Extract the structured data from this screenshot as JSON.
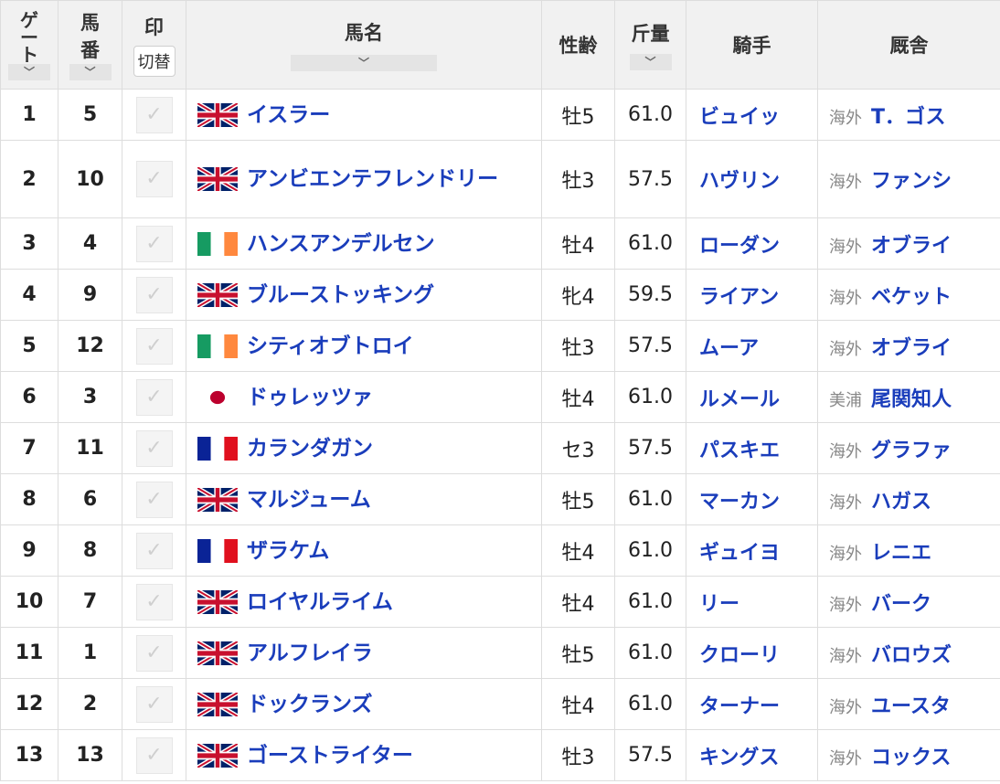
{
  "headers": {
    "gate": [
      "ゲ",
      "ー",
      "ト"
    ],
    "number": [
      "馬",
      "番"
    ],
    "mark": "印",
    "mark_toggle": "切替",
    "horse": "馬名",
    "sex_age": "性齢",
    "weight": "斤量",
    "jockey": "騎手",
    "stable": "厩舎",
    "sort_icon": "﹀"
  },
  "check_glyph": "✓",
  "rows": [
    {
      "gate": "1",
      "num": "5",
      "flag": "gb",
      "horse": "イスラー",
      "sex_age": "牡5",
      "weight": "61.0",
      "jockey": "ビュイッ",
      "region": "海外",
      "trainer": "T．ゴス"
    },
    {
      "gate": "2",
      "num": "10",
      "flag": "gb",
      "horse": "アンビエンテフレンドリー",
      "sex_age": "牡3",
      "weight": "57.5",
      "jockey": "ハヴリン",
      "region": "海外",
      "trainer": "ファンシ",
      "tall": true
    },
    {
      "gate": "3",
      "num": "4",
      "flag": "ie",
      "horse": "ハンスアンデルセン",
      "sex_age": "牡4",
      "weight": "61.0",
      "jockey": "ローダン",
      "region": "海外",
      "trainer": "オブライ"
    },
    {
      "gate": "4",
      "num": "9",
      "flag": "gb",
      "horse": "ブルーストッキング",
      "sex_age": "牝4",
      "weight": "59.5",
      "jockey": "ライアン",
      "region": "海外",
      "trainer": "ベケット"
    },
    {
      "gate": "5",
      "num": "12",
      "flag": "ie",
      "horse": "シティオブトロイ",
      "sex_age": "牡3",
      "weight": "57.5",
      "jockey": "ムーア",
      "region": "海外",
      "trainer": "オブライ"
    },
    {
      "gate": "6",
      "num": "3",
      "flag": "jp",
      "horse": "ドゥレッツァ",
      "sex_age": "牡4",
      "weight": "61.0",
      "jockey": "ルメール",
      "region": "美浦",
      "trainer": "尾関知人"
    },
    {
      "gate": "7",
      "num": "11",
      "flag": "fr",
      "horse": "カランダガン",
      "sex_age": "セ3",
      "weight": "57.5",
      "jockey": "パスキエ",
      "region": "海外",
      "trainer": "グラファ"
    },
    {
      "gate": "8",
      "num": "6",
      "flag": "gb",
      "horse": "マルジューム",
      "sex_age": "牡5",
      "weight": "61.0",
      "jockey": "マーカン",
      "region": "海外",
      "trainer": "ハガス"
    },
    {
      "gate": "9",
      "num": "8",
      "flag": "fr",
      "horse": "ザラケム",
      "sex_age": "牡4",
      "weight": "61.0",
      "jockey": "ギュイヨ",
      "region": "海外",
      "trainer": "レニエ"
    },
    {
      "gate": "10",
      "num": "7",
      "flag": "gb",
      "horse": "ロイヤルライム",
      "sex_age": "牡4",
      "weight": "61.0",
      "jockey": "リー",
      "region": "海外",
      "trainer": "バーク"
    },
    {
      "gate": "11",
      "num": "1",
      "flag": "gb",
      "horse": "アルフレイラ",
      "sex_age": "牡5",
      "weight": "61.0",
      "jockey": "クローリ",
      "region": "海外",
      "trainer": "バロウズ"
    },
    {
      "gate": "12",
      "num": "2",
      "flag": "gb",
      "horse": "ドックランズ",
      "sex_age": "牡4",
      "weight": "61.0",
      "jockey": "ターナー",
      "region": "海外",
      "trainer": "ユースタ"
    },
    {
      "gate": "13",
      "num": "13",
      "flag": "gb",
      "horse": "ゴーストライター",
      "sex_age": "牡3",
      "weight": "57.5",
      "jockey": "キングス",
      "region": "海外",
      "trainer": "コックス"
    }
  ]
}
